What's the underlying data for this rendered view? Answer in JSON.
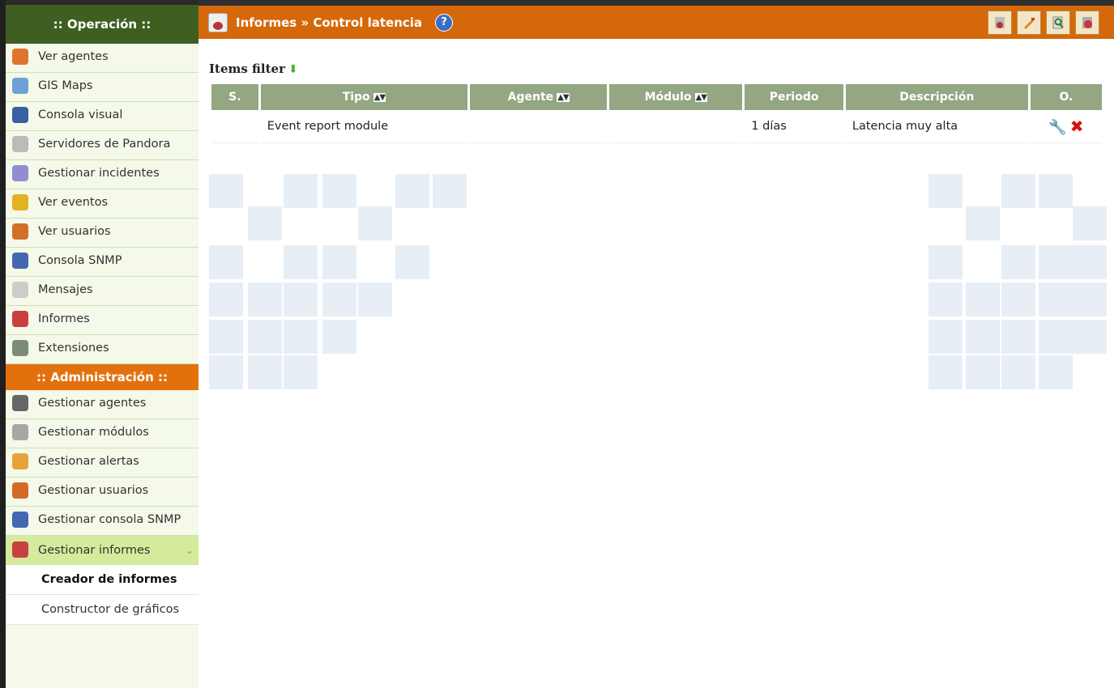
{
  "sidebar": {
    "operacion_header": ":: Operación ::",
    "operacion_items": [
      {
        "label": "Ver agentes",
        "icon": "agents-icon",
        "color": "#e0742d"
      },
      {
        "label": "GIS Maps",
        "icon": "gis-maps-icon",
        "color": "#6ea1d6"
      },
      {
        "label": "Consola visual",
        "icon": "visual-console-icon",
        "color": "#3a5fa0"
      },
      {
        "label": "Servidores de Pandora",
        "icon": "servers-icon",
        "color": "#bbbbbb"
      },
      {
        "label": "Gestionar incidentes",
        "icon": "incidents-icon",
        "color": "#8f8fd0"
      },
      {
        "label": "Ver eventos",
        "icon": "events-icon",
        "color": "#e3b220"
      },
      {
        "label": "Ver usuarios",
        "icon": "users-icon",
        "color": "#d46f2a"
      },
      {
        "label": "Consola SNMP",
        "icon": "snmp-console-icon",
        "color": "#4467b2"
      },
      {
        "label": "Mensajes",
        "icon": "messages-icon",
        "color": "#cccccc"
      },
      {
        "label": "Informes",
        "icon": "reports-icon",
        "color": "#c94040"
      },
      {
        "label": "Extensiones",
        "icon": "extensions-icon",
        "color": "#7b8a7b"
      }
    ],
    "admin_header": ":: Administración ::",
    "admin_items": [
      {
        "label": "Gestionar agentes",
        "icon": "manage-agents-icon",
        "color": "#666666"
      },
      {
        "label": "Gestionar módulos",
        "icon": "manage-modules-icon",
        "color": "#a7a7a7"
      },
      {
        "label": "Gestionar alertas",
        "icon": "manage-alerts-icon",
        "color": "#e8a23c"
      },
      {
        "label": "Gestionar usuarios",
        "icon": "manage-users-icon",
        "color": "#d36b25"
      },
      {
        "label": "Gestionar consola SNMP",
        "icon": "manage-snmp-icon",
        "color": "#4467b2"
      }
    ],
    "active_item": {
      "label": "Gestionar informes",
      "icon": "manage-reports-icon",
      "color": "#c94040",
      "chevron": "⌄"
    },
    "sub_items": [
      {
        "label": "Creador de informes",
        "bold": true
      },
      {
        "label": "Constructor de gráficos",
        "bold": false
      }
    ]
  },
  "header": {
    "title": "Informes » Control latencia",
    "help": "?"
  },
  "toolbar": {
    "icons": [
      "report-list-icon",
      "edit-report-icon",
      "view-report-icon",
      "report-icon"
    ]
  },
  "main": {
    "filter_label": "Items filter",
    "columns": [
      "S.",
      "Tipo",
      "Agente",
      "Módulo",
      "Periodo",
      "Descripción",
      "O."
    ],
    "rows": [
      {
        "s": "",
        "tipo": "Event report module",
        "agente": "",
        "modulo": "",
        "periodo": "1 días",
        "descripcion": "Latencia muy alta"
      }
    ]
  },
  "colors": {
    "header_orange": "#d5680a",
    "sidebar_green": "#3e5f21",
    "table_header": "#95a682",
    "delete_red": "#d31010"
  }
}
